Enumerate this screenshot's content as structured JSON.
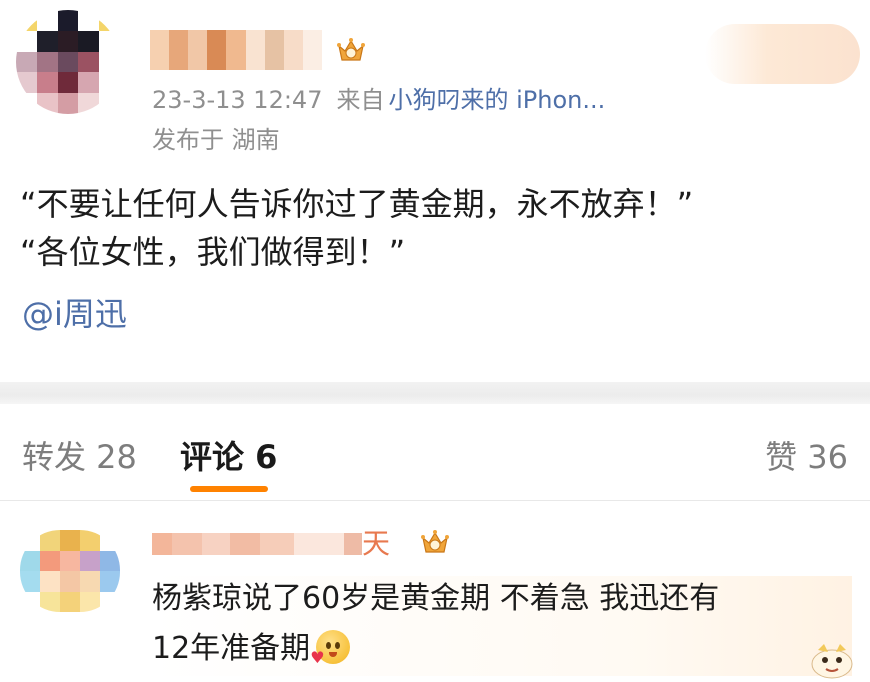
{
  "post": {
    "timestamp": "23-3-13 12:47",
    "source_prefix": "来自",
    "source_device": "小狗叼来的 iPhon...",
    "location": "发布于 湖南",
    "lines": [
      "“不要让任何人告诉你过了黄金期，永不放弃！”",
      "“各位女性，我们做得到！”"
    ],
    "mention": "@i周迅"
  },
  "tabs": {
    "repost": "转发 28",
    "comment": "评论 6",
    "like": "赞 36"
  },
  "comment": {
    "name_visible_fragment": "天",
    "lines": [
      "杨紫琼说了60岁是黄金期 不着急 我迅还有",
      "12年准备期"
    ]
  },
  "icons": {
    "badge": "crown-badge-icon",
    "emoji": "blush-heart-emoji-icon",
    "sticker": "sticker-icon"
  },
  "colors": {
    "link": "#4e6fa8",
    "accent": "#ff8200",
    "meta": "#8f8f8f",
    "text": "#1c1c1c"
  }
}
